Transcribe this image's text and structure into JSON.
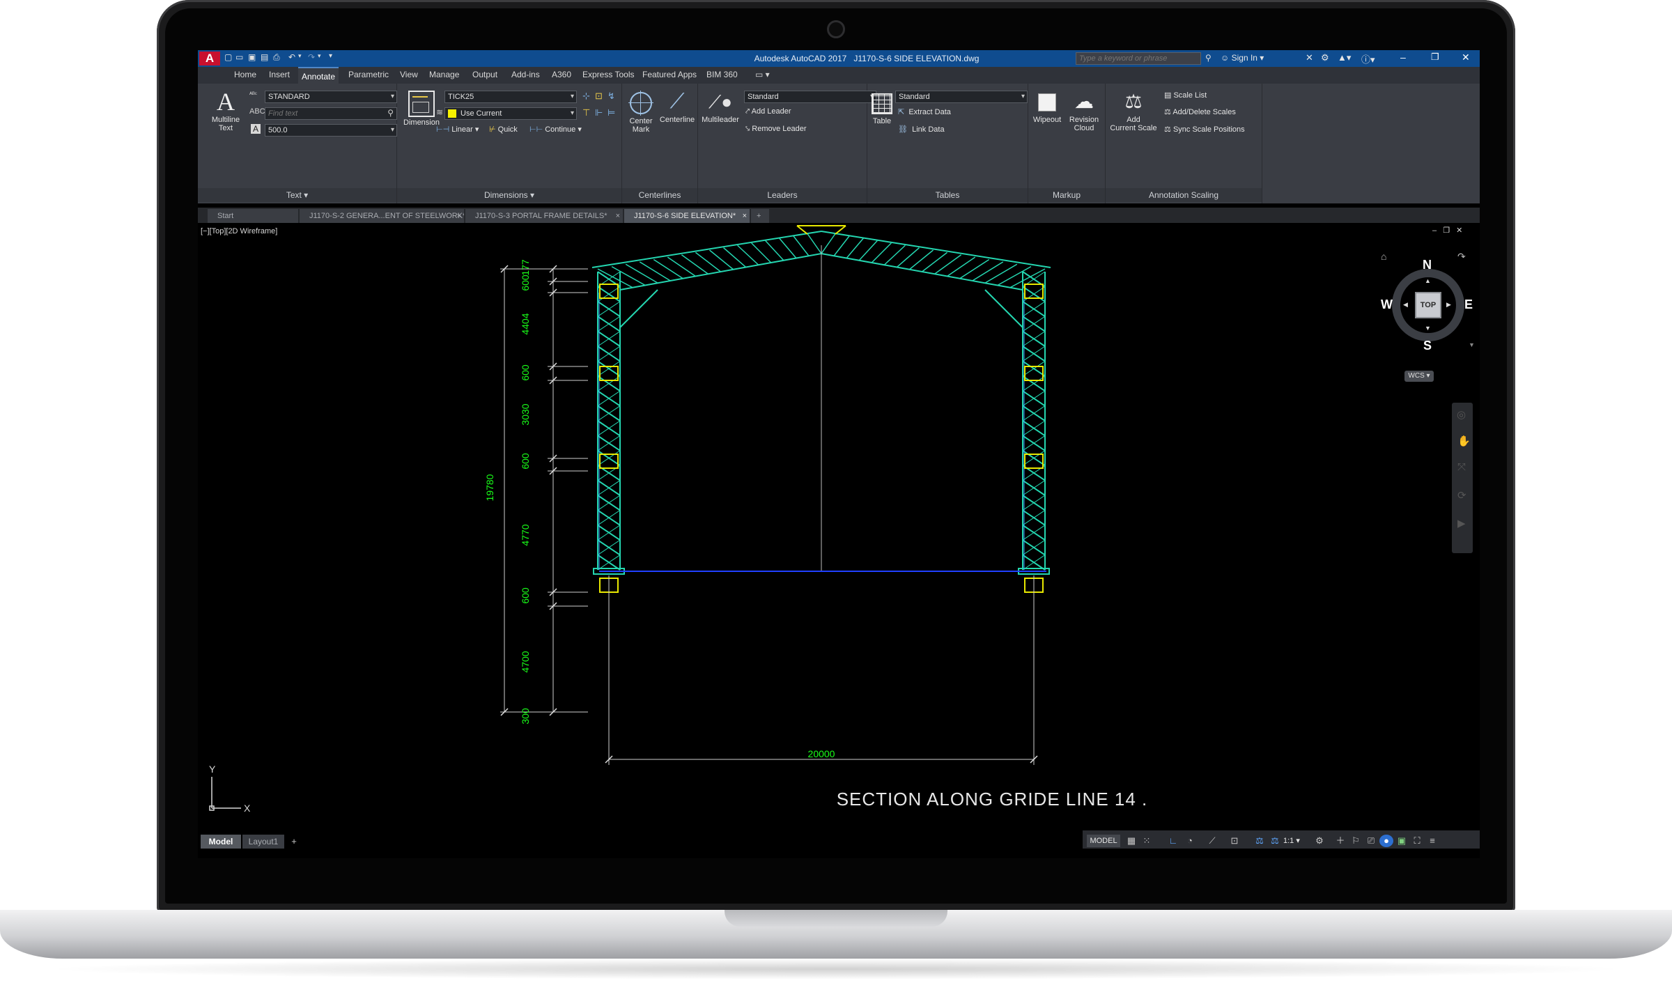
{
  "app": {
    "title": "Autodesk AutoCAD 2017",
    "filename": "J1170-S-6 SIDE ELEVATION.dwg",
    "search_placeholder": "Type a keyword or phrase",
    "sign_in": "Sign In",
    "app_letter": "A"
  },
  "menu_tabs": [
    "Home",
    "Insert",
    "Annotate",
    "Parametric",
    "View",
    "Manage",
    "Output",
    "Add-ins",
    "A360",
    "Express Tools",
    "Featured Apps",
    "BIM 360"
  ],
  "active_tab": "Annotate",
  "ribbon": {
    "text_panel": {
      "multiline_label": "Multiline",
      "multiline_label2": "Text",
      "style_value": "STANDARD",
      "find_placeholder": "Find text",
      "height_value": "500.0",
      "panel_title": "Text ▾"
    },
    "dimensions_panel": {
      "dimension_label": "Dimension",
      "style_value": "TICK25",
      "layer_value": "Use Current",
      "linear_label": "Linear",
      "quick_label": "Quick",
      "continue_label": "Continue",
      "panel_title": "Dimensions ▾"
    },
    "centerlines_panel": {
      "center_mark_label": "Center",
      "center_mark_label2": "Mark",
      "centerline_label": "Centerline",
      "panel_title": "Centerlines"
    },
    "leaders_panel": {
      "multileader_label": "Multileader",
      "style_value": "Standard",
      "add_leader": "Add Leader",
      "remove_leader": "Remove Leader",
      "panel_title": "Leaders"
    },
    "tables_panel": {
      "table_label": "Table",
      "style_value": "Standard",
      "extract_data": "Extract Data",
      "link_data": "Link Data",
      "panel_title": "Tables"
    },
    "markup_panel": {
      "wipeout_label": "Wipeout",
      "revision_label": "Revision",
      "revision_label2": "Cloud",
      "panel_title": "Markup"
    },
    "scaling_panel": {
      "add_label": "Add",
      "add_label2": "Current Scale",
      "scale_list": "Scale List",
      "add_delete_scales": "Add/Delete Scales",
      "sync_scale_positions": "Sync Scale Positions",
      "panel_title": "Annotation Scaling"
    }
  },
  "doc_tabs": [
    "Start",
    "J1170-S-2  GENERA...ENT OF STEELWORK*",
    "J1170-S-3  PORTAL  FRAME  DETAILS*",
    "J1170-S-6 SIDE ELEVATION*"
  ],
  "active_doc_tab": "J1170-S-6 SIDE ELEVATION*",
  "viewport": {
    "label": "[−][Top][2D Wireframe]",
    "caption": "SECTION  ALONG  GRIDE  LINE  14 .",
    "ucs_y": "Y",
    "ucs_x": "X"
  },
  "viewcube": {
    "north": "N",
    "south": "S",
    "east": "E",
    "west": "W",
    "top": "TOP",
    "wcs": "WCS"
  },
  "drawing": {
    "vertical_dims": [
      "177",
      "600",
      "4404",
      "600",
      "3030",
      "600",
      "4770",
      "600",
      "4700",
      "300"
    ],
    "overall_height": "19780",
    "span": "20000"
  },
  "layout_tabs": [
    "Model",
    "Layout1"
  ],
  "status": {
    "model_label": "MODEL",
    "scale": "1:1"
  },
  "colors": {
    "title_bar": "#0f4c8f",
    "ribbon": "#3a3d44",
    "truss": "#24d6b0",
    "dimension": "#19ff19",
    "brace": "#e8e800"
  }
}
